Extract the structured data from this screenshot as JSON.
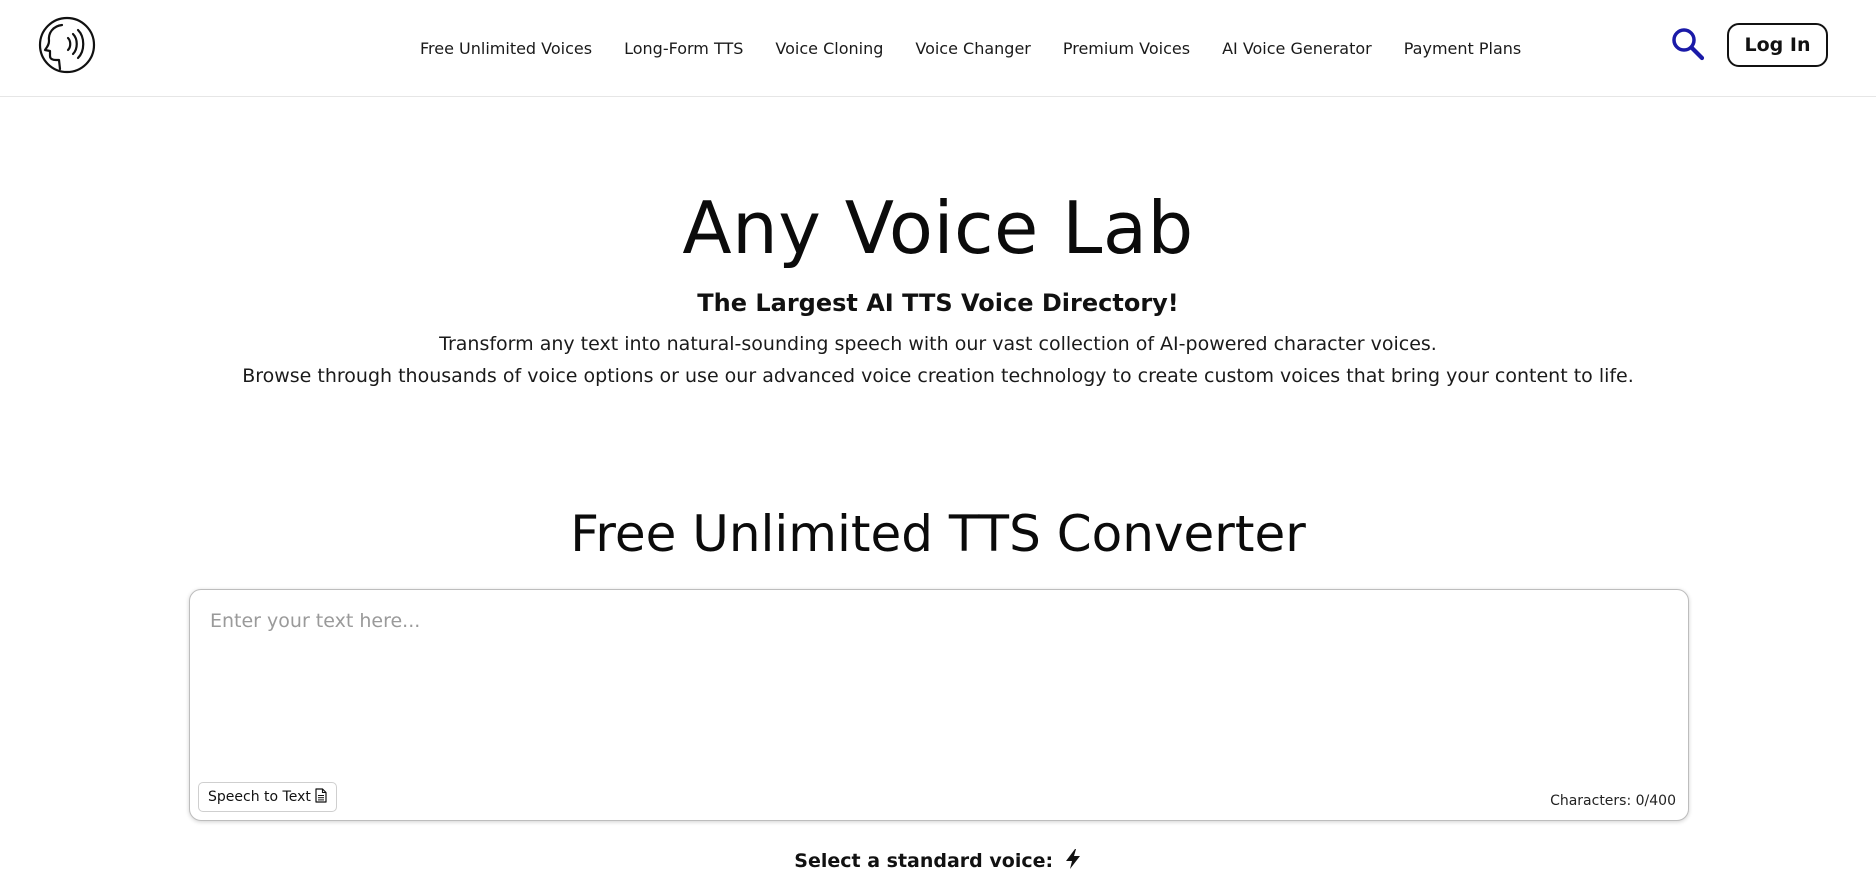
{
  "header": {
    "logo_icon": "speaking-head-icon",
    "nav": [
      {
        "label": "Free Unlimited Voices"
      },
      {
        "label": "Long-Form TTS"
      },
      {
        "label": "Voice Cloning"
      },
      {
        "label": "Voice Changer"
      },
      {
        "label": "Premium Voices"
      },
      {
        "label": "AI Voice Generator"
      },
      {
        "label": "Payment Plans"
      }
    ],
    "search_icon": "search-icon",
    "search_color": "#1a1aa8",
    "login_label": "Log In"
  },
  "hero": {
    "title": "Any Voice Lab",
    "subtitle": "The Largest AI TTS Voice Directory!",
    "description_line1": "Transform any text into natural-sounding speech with our vast collection of AI-powered character voices.",
    "description_line2": "Browse through thousands of voice options or use our advanced voice creation technology to create custom voices that bring your content to life."
  },
  "converter": {
    "title": "Free Unlimited TTS Converter",
    "input_value": "",
    "input_placeholder": "Enter your text here...",
    "speech_to_text_label": "Speech to Text",
    "speech_to_text_icon": "document-icon",
    "char_count": "Characters: 0/400",
    "select_voice_label": "Select a standard voice:",
    "select_voice_icon": "lightning-bolt-icon"
  }
}
